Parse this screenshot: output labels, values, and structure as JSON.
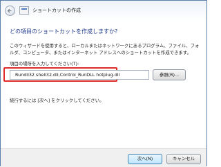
{
  "window": {
    "title": "ショートカットの作成"
  },
  "wizard": {
    "heading": "どの項目のショートカットを作成しますか?",
    "description": "このウィザードを使用すると、ローカルまたはネットワークにあるプログラム、ファイル、フォルダ、コンピュータ、またはインターネット アドレスへのショートカットを作成できます。",
    "location_label": "項目の場所を入力してください(T):",
    "location_value": "Rundll32 shell32.dll,Control_RunDLL hotplug.dll",
    "browse_label": "参照(R)...",
    "continue_text": "続行するには [次へ] をクリックしてください。"
  },
  "footer": {
    "next_label": "次へ(N)",
    "cancel_label": "キャンセル"
  },
  "colors": {
    "accent_heading": "#1e3a8a",
    "highlight": "#e02a2a",
    "default_button": "#3c7fb1"
  },
  "icons": [
    "back-arrow-icon",
    "wizard-icon"
  ]
}
